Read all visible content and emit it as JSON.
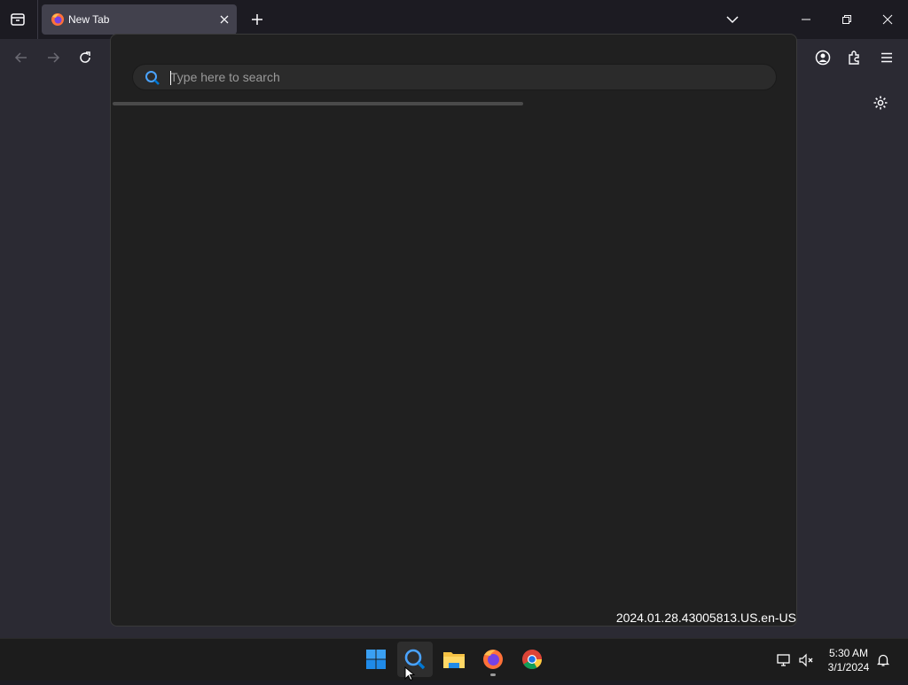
{
  "browser": {
    "tab_title": "New Tab"
  },
  "search": {
    "placeholder": "Type here to search",
    "value": "",
    "loading_progress": 0.6
  },
  "version": "2024.01.28.43005813.US.en-US",
  "taskbar": {
    "time": "5:30 AM",
    "date": "3/1/2024",
    "apps": [
      "start-icon",
      "search-icon",
      "file-explorer-icon",
      "firefox-icon",
      "chrome-icon"
    ]
  },
  "colors": {
    "accent": "#0078d4",
    "flyout_bg": "#202020",
    "page_bg": "#2b2a33"
  }
}
